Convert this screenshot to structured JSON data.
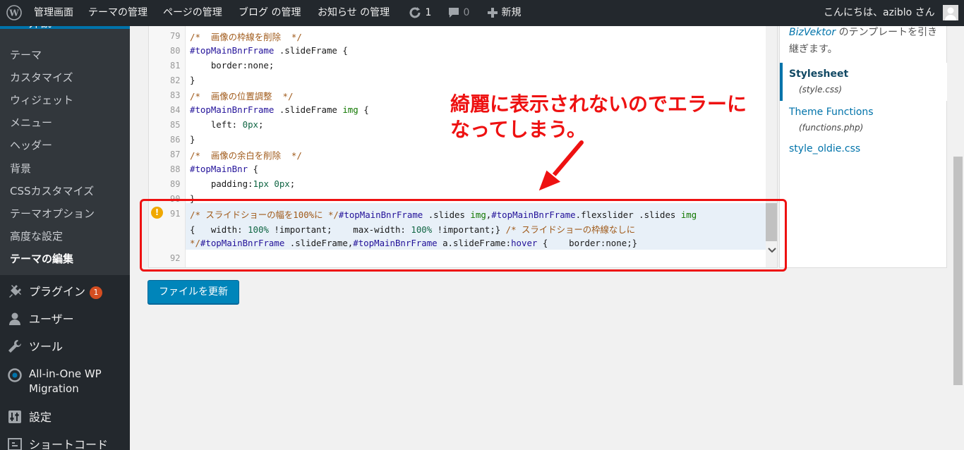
{
  "adminbar": {
    "wp_logo_icon": "wordpress-icon",
    "items": [
      "管理画面",
      "テーマの管理",
      "ページの管理",
      "ブログ の管理",
      "お知らせ の管理"
    ],
    "updates_count": "1",
    "comments_count": "0",
    "new_label": "新規",
    "greeting": "こんにちは、aziblo さん"
  },
  "sidebar": {
    "current_section_partial": "外観",
    "submenu": [
      "テーマ",
      "カスタマイズ",
      "ウィジェット",
      "メニュー",
      "ヘッダー",
      "背景",
      "CSSカスタマイズ",
      "テーマオプション",
      "高度な設定",
      "テーマの編集"
    ],
    "current_submenu_index": 9,
    "main": [
      {
        "label": "プラグイン",
        "badge": "1",
        "icon": "plugin-icon"
      },
      {
        "label": "ユーザー",
        "icon": "user-icon"
      },
      {
        "label": "ツール",
        "icon": "wrench-icon"
      },
      {
        "label": "All-in-One WP Migration",
        "icon": "migration-icon"
      },
      {
        "label": "設定",
        "icon": "settings-icon"
      },
      {
        "label": "ショートコード",
        "icon": "shortcode-icon"
      }
    ]
  },
  "editor": {
    "line_numbers": [
      "79",
      "80",
      "81",
      "82",
      "83",
      "84",
      "85",
      "86",
      "87",
      "88",
      "89",
      "90",
      "91",
      "92"
    ],
    "lines": {
      "l79": "/*  画像の枠線を削除  */",
      "l80_sel": "#topMainBnrFrame",
      "l80_rest": " .slideFrame {",
      "l81": "    border:none;",
      "l82": "}",
      "l83": "/*  画像の位置調整  */",
      "l84_sel": "#topMainBnrFrame",
      "l84_mid": " .slideFrame ",
      "l84_tag": "img",
      "l84_end": " {",
      "l85_pre": "    left: ",
      "l85_num": "0px",
      "l85_end": ";",
      "l86": "}",
      "l87": "/*  画像の余白を削除  */",
      "l88_sel": "#topMainBnr",
      "l88_end": " {",
      "l89_pre": "    padding:",
      "l89_num": "1px 0px",
      "l89_end": ";",
      "l90": "}",
      "l91a_com": "/* スライドショーの幅を100%に */",
      "l91a_sel1": "#topMainBnrFrame",
      "l91a_mid1": " .slides ",
      "l91a_tag1": "img",
      "l91a_comma": ",",
      "l91a_sel2": "#topMainBnrFrame",
      "l91a_mid2": ".flexslider .slides ",
      "l91a_tag2": "img",
      "l91b_open": "{",
      "l91b_w": "   width: ",
      "l91b_wv": "100%",
      "l91b_imp1": " !important;",
      "l91b_mw": "    max-width: ",
      "l91b_mwv": "100%",
      "l91b_imp2": " !important;}",
      "l91b_com": " /* スライドショーの枠線なしに",
      "l91c_com": "*/",
      "l91c_sel1": "#topMainBnrFrame",
      "l91c_mid1": " .slideFrame,",
      "l91c_sel2": "#topMainBnrFrame",
      "l91c_mid2": " a.slideFrame:",
      "l91c_kw": "hover",
      "l91c_end": " {    border:none;}"
    },
    "warning_icon": "warning-icon"
  },
  "files": {
    "description_link": "BizVektor",
    "description_text": " のテンプレートを引き継ぎます。",
    "items": [
      {
        "name": "Stylesheet",
        "path": "(style.css)",
        "current": true
      },
      {
        "name": "Theme Functions",
        "path": "(functions.php)"
      },
      {
        "name": "style_oldie.css",
        "path": ""
      }
    ]
  },
  "update_button": "ファイルを更新",
  "annotation": {
    "line1": "綺麗に表示されないのでエラーに",
    "line2": "なってしまう。",
    "color": "#ee1111"
  }
}
